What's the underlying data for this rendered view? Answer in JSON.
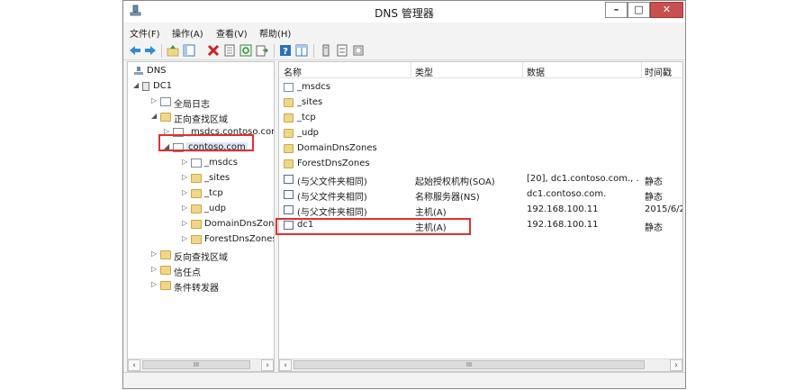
{
  "window": {
    "title": "DNS 管理器",
    "controls": {
      "minimize": "–",
      "maximize": "□",
      "close": "✕"
    }
  },
  "menu": [
    "文件(F)",
    "操作(A)",
    "查看(V)",
    "帮助(H)"
  ],
  "toolbar": {
    "icons": [
      "back-icon",
      "forward-icon",
      "up-icon",
      "show-tree-icon",
      "delete-icon",
      "properties-icon",
      "refresh-icon",
      "export-icon",
      "help-icon",
      "console-icon",
      "new-host-icon",
      "new-alias-icon",
      "new-mail-exchanger-icon"
    ]
  },
  "tree": {
    "root": "DNS",
    "server": "DC1",
    "global_logs": "全局日志",
    "forward_zones": "正向查找区域",
    "msdcs_zone": "_msdcs.contoso.com",
    "selected_zone": "contoso.com",
    "zone_children": [
      "_msdcs",
      "_sites",
      "_tcp",
      "_udp",
      "DomainDnsZones",
      "ForestDnsZones"
    ],
    "reverse_zones": "反向查找区域",
    "trust_points": "信任点",
    "conditional_forwarders": "条件转发器"
  },
  "list": {
    "columns": [
      "名称",
      "类型",
      "数据",
      "时间戳"
    ],
    "rows": [
      {
        "name": "_msdcs",
        "type": "",
        "data": "",
        "time": "",
        "icon": "zone"
      },
      {
        "name": "_sites",
        "type": "",
        "data": "",
        "time": "",
        "icon": "folder"
      },
      {
        "name": "_tcp",
        "type": "",
        "data": "",
        "time": "",
        "icon": "folder"
      },
      {
        "name": "_udp",
        "type": "",
        "data": "",
        "time": "",
        "icon": "folder"
      },
      {
        "name": "DomainDnsZones",
        "type": "",
        "data": "",
        "time": "",
        "icon": "folder"
      },
      {
        "name": "ForestDnsZones",
        "type": "",
        "data": "",
        "time": "",
        "icon": "folder"
      },
      {
        "name": "(与父文件夹相同)",
        "type": "起始授权机构(SOA)",
        "data": "[20], dc1.contoso.com., ...",
        "time": "静态",
        "icon": "record"
      },
      {
        "name": "(与父文件夹相同)",
        "type": "名称服务器(NS)",
        "data": "dc1.contoso.com.",
        "time": "静态",
        "icon": "record"
      },
      {
        "name": "(与父文件夹相同)",
        "type": "主机(A)",
        "data": "192.168.100.11",
        "time": "2015/6/2",
        "icon": "record"
      },
      {
        "name": "dc1",
        "type": "主机(A)",
        "data": "192.168.100.11",
        "time": "静态",
        "icon": "record"
      }
    ]
  },
  "scroll": {
    "left": "‹",
    "right": "›",
    "thumb": "III"
  },
  "colors": {
    "highlight": "#e03030",
    "folder": "#f0d68a",
    "window_bg": "#f3f3f3"
  }
}
